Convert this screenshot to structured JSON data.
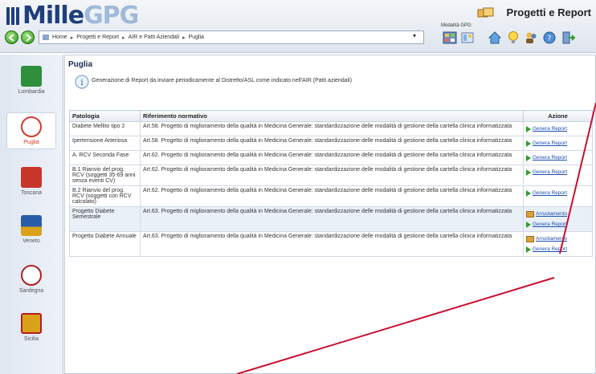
{
  "header": {
    "logo_prefix": "Mille",
    "logo_suffix": "GPG",
    "app_title": "Progetti e Report",
    "modules_label": "Modalità GPG"
  },
  "breadcrumb": [
    "Home",
    "Progetti e Report",
    "AIR e Patti Aziendali",
    "Puglia"
  ],
  "sidebar": [
    {
      "label": "Lombardia",
      "color": "#2f8f3a"
    },
    {
      "label": "Puglia",
      "color": "#d23a2a"
    },
    {
      "label": "Toscana",
      "color": "#c8352b"
    },
    {
      "label": "Veneto",
      "color": "#2a5da8"
    },
    {
      "label": "Sardegna",
      "color": "#b02020"
    },
    {
      "label": "Sicilia",
      "color": "#d9a21a"
    }
  ],
  "page": {
    "title": "Puglia",
    "description": "Generazione di Report da inviare periodicamente al Distretto/ASL come indicato nell'AIR (Patti aziendali)"
  },
  "table": {
    "columns": [
      "Patologia",
      "Riferimento normativo",
      "Azione"
    ],
    "rows": [
      {
        "patologia": "Diabete Mellito tipo 2",
        "riferimento": "Art.58. Progetto di miglioramento della qualità in Medicina Generale: standardizzazione delle modalità di gestione della cartella clinica informatizzata",
        "actions": [
          "Genera Report"
        ]
      },
      {
        "patologia": "Ipertensione Arteriosa",
        "riferimento": "Art.58. Progetto di miglioramento della qualità in Medicina Generale: standardizzazione delle modalità di gestione della cartella clinica informatizzata",
        "actions": [
          "Genera Report"
        ]
      },
      {
        "patologia": "A. RCV Seconda Fase",
        "riferimento": "Art.62. Progetto di miglioramento della qualità in Medicina Generale: standardizzazione delle modalità di gestione della cartella clinica informatizzata",
        "actions": [
          "Genera Report"
        ]
      },
      {
        "patologia": "B.1 Rianvio del prog. RCV (soggetti 35-69 anni senza eventi CV)",
        "riferimento": "Art.62. Progetto di miglioramento della qualità in Medicina Generale: standardizzazione delle modalità di gestione della cartella clinica informatizzata",
        "actions": [
          "Genera Report"
        ]
      },
      {
        "patologia": "B.2 Rianvio del prog. RCV (soggetti con RCV calcolato)",
        "riferimento": "Art.62. Progetto di miglioramento della qualità in Medicina Generale: standardizzazione delle modalità di gestione della cartella clinica informatizzata",
        "actions": [
          "Genera Report"
        ]
      },
      {
        "patologia": "Progetto Diabete Semestrale",
        "riferimento": "Art.63. Progetto di miglioramento della qualità in Medicina Generale: standardizzazione delle modalità di gestione della cartella clinica informatizzata",
        "actions": [
          "Arruolamento",
          "Genera Report"
        ],
        "highlight": true
      },
      {
        "patologia": "Progetto Diabete Annuale",
        "riferimento": "Art.63. Progetto di miglioramento della qualità in Medicina Generale: standardizzazione delle modalità di gestione della cartella clinica informatizzata",
        "actions": [
          "Arruolamento",
          "Genera Report"
        ]
      }
    ]
  },
  "colors": {
    "annotation": "#c8102e",
    "link": "#1a4fb0",
    "play": "#2ea02a"
  }
}
